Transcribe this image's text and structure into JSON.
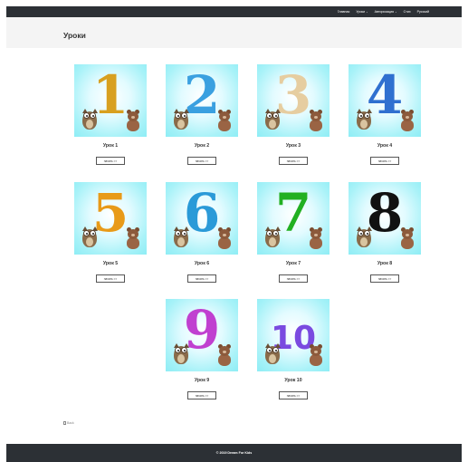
{
  "nav": {
    "items": [
      {
        "label": "Главная",
        "has_caret": false
      },
      {
        "label": "Уроки",
        "has_caret": true
      },
      {
        "label": "Авторизация",
        "has_caret": true
      },
      {
        "label": "Стих",
        "has_caret": false
      },
      {
        "label": "Русский",
        "has_caret": false
      }
    ],
    "caret_glyph": "⌄"
  },
  "header": {
    "title": "Уроки"
  },
  "lessons": [
    {
      "label": "Урок 1",
      "digit": "1",
      "color": "#d8a020",
      "button": "начать >>"
    },
    {
      "label": "Урок 2",
      "digit": "2",
      "color": "#3aa0e0",
      "button": "начать >>"
    },
    {
      "label": "Урок 3",
      "digit": "3",
      "color": "#e6cda0",
      "button": "начать >>"
    },
    {
      "label": "Урок 4",
      "digit": "4",
      "color": "#3070d0",
      "button": "начать >>"
    },
    {
      "label": "Урок 5",
      "digit": "5",
      "color": "#e89a18",
      "button": "начать >>"
    },
    {
      "label": "Урок 6",
      "digit": "6",
      "color": "#2a9ad8",
      "button": "начать >>"
    },
    {
      "label": "Урок 7",
      "digit": "7",
      "color": "#22b022",
      "button": "начать >>"
    },
    {
      "label": "Урок 8",
      "digit": "8",
      "color": "#111111",
      "button": "начать >>"
    },
    {
      "label": "Урок 9",
      "digit": "9",
      "color": "#c040d0",
      "button": "начать >>"
    },
    {
      "label": "Урок 10",
      "digit": "10",
      "color": "#7a4ae0",
      "button": "начать >>"
    }
  ],
  "ext_link": {
    "label": "Back"
  },
  "footer": {
    "copyright": "© 2019 Dream For Kids"
  }
}
